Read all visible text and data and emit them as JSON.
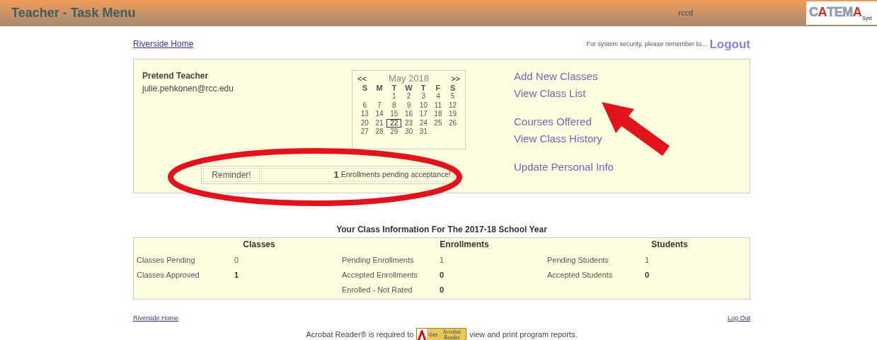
{
  "header": {
    "title": "Teacher - Task Menu",
    "user": "rccd",
    "logo": {
      "parts": [
        "C",
        "A",
        "TEM",
        "A"
      ],
      "suffix": "Syst"
    }
  },
  "top_links": {
    "home": "Riverside Home",
    "security_note": "For system security, please remember to...",
    "logout": "Logout"
  },
  "profile": {
    "name": "Pretend Teacher",
    "email": "julie.pehkonen@rcc.edu"
  },
  "calendar": {
    "prev": "<<",
    "month": "May 2018",
    "next": ">>",
    "weekdays": [
      "S",
      "M",
      "T",
      "W",
      "T",
      "F",
      "S"
    ],
    "weeks": [
      [
        {
          "day": "1",
          "selected": false
        },
        {
          "day": "2",
          "selected": false
        },
        {
          "day": "3",
          "selected": false
        },
        {
          "day": "4",
          "selected": false
        },
        {
          "day": "5",
          "selected": false
        }
      ],
      [
        {
          "day": "6",
          "selected": false
        },
        {
          "day": "7",
          "selected": false
        },
        {
          "day": "8",
          "selected": false
        },
        {
          "day": "9",
          "selected": false
        },
        {
          "day": "10",
          "selected": false
        },
        {
          "day": "11",
          "selected": false
        },
        {
          "day": "12",
          "selected": false
        }
      ],
      [
        {
          "day": "13",
          "selected": false
        },
        {
          "day": "14",
          "selected": false
        },
        {
          "day": "15",
          "selected": false
        },
        {
          "day": "16",
          "selected": false
        },
        {
          "day": "17",
          "selected": false
        },
        {
          "day": "18",
          "selected": false
        },
        {
          "day": "19",
          "selected": false
        }
      ],
      [
        {
          "day": "20",
          "selected": false
        },
        {
          "day": "21",
          "selected": false
        },
        {
          "day": "22",
          "selected": true
        },
        {
          "day": "23",
          "selected": false
        },
        {
          "day": "24",
          "selected": false
        },
        {
          "day": "25",
          "selected": false
        },
        {
          "day": "26",
          "selected": false
        }
      ],
      [
        {
          "day": "27",
          "selected": false
        },
        {
          "day": "28",
          "selected": false
        },
        {
          "day": "29",
          "selected": false
        },
        {
          "day": "30",
          "selected": false
        },
        {
          "day": "31",
          "selected": false
        }
      ]
    ]
  },
  "reminder": {
    "label": "Reminder!",
    "count": "1",
    "message": "Enrollments pending acceptance!"
  },
  "menu": [
    [
      "Add New Classes",
      "View Class List"
    ],
    [
      "Courses Offered",
      "View Class History"
    ],
    [
      "Update Personal Info"
    ]
  ],
  "class_info": {
    "title": "Your Class Information For The 2017-18 School Year",
    "groups": [
      {
        "heading": "Classes",
        "rows": [
          {
            "label": "Classes Pending",
            "value": "0",
            "bold": false
          },
          {
            "label": "Classes Approved",
            "value": "1",
            "bold": true
          }
        ]
      },
      {
        "heading": "Enrollments",
        "rows": [
          {
            "label": "Pending Enrollments",
            "value": "1",
            "bold": false
          },
          {
            "label": "Accepted Enrollments",
            "value": "0",
            "bold": true
          },
          {
            "label": "Enrolled - Not Rated",
            "value": "0",
            "bold": true
          }
        ]
      },
      {
        "heading": "Students",
        "rows": [
          {
            "label": "Pending Students",
            "value": "1",
            "bold": false
          },
          {
            "label": "Accepted Students",
            "value": "0",
            "bold": true
          }
        ]
      }
    ]
  },
  "footer": {
    "home": "Riverside Home",
    "logout": "Log Out",
    "acrobat_before": "Acrobat Reader® is required to",
    "badge_get": "Get",
    "badge_name": "Acrobat Reader",
    "acrobat_after": "view and print program reports."
  }
}
